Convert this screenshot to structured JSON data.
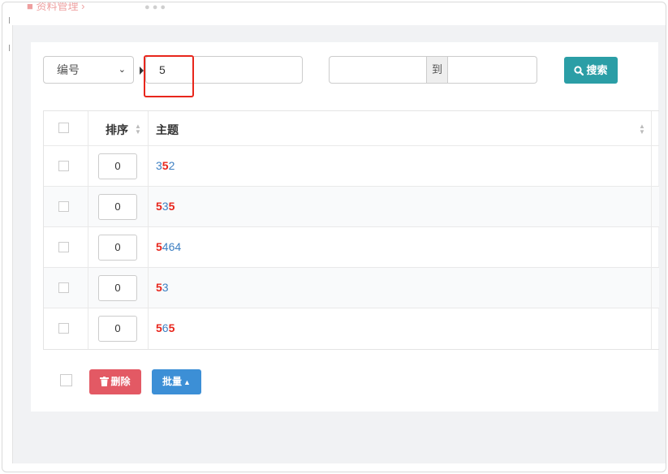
{
  "breadcrumb": {
    "text": "■ 资料管理 ›"
  },
  "filter": {
    "field_select": "编号",
    "keyword_value": "5",
    "range_from": "",
    "range_separator": "到",
    "range_to": "",
    "search_label": "搜索"
  },
  "table": {
    "headers": {
      "order": "排序",
      "topic": "主题"
    },
    "rows": [
      {
        "order": "0",
        "topic": [
          {
            "t": "3",
            "hl": false
          },
          {
            "t": "5",
            "hl": true
          },
          {
            "t": "2",
            "hl": false
          }
        ]
      },
      {
        "order": "0",
        "topic": [
          {
            "t": "5",
            "hl": true
          },
          {
            "t": "3",
            "hl": false
          },
          {
            "t": "5",
            "hl": true
          }
        ]
      },
      {
        "order": "0",
        "topic": [
          {
            "t": "5",
            "hl": true
          },
          {
            "t": "464",
            "hl": false
          }
        ]
      },
      {
        "order": "0",
        "topic": [
          {
            "t": "5",
            "hl": true
          },
          {
            "t": "3",
            "hl": false
          }
        ]
      },
      {
        "order": "0",
        "topic": [
          {
            "t": "5",
            "hl": true
          },
          {
            "t": "6",
            "hl": false
          },
          {
            "t": "5",
            "hl": true
          }
        ]
      }
    ]
  },
  "actions": {
    "delete_label": "删除",
    "batch_label": "批量"
  },
  "colors": {
    "accent_teal": "#2b9ea6",
    "danger": "#e35964",
    "primary": "#3c8fd6",
    "highlight": "#e8261c",
    "link": "#3d7fc2"
  }
}
